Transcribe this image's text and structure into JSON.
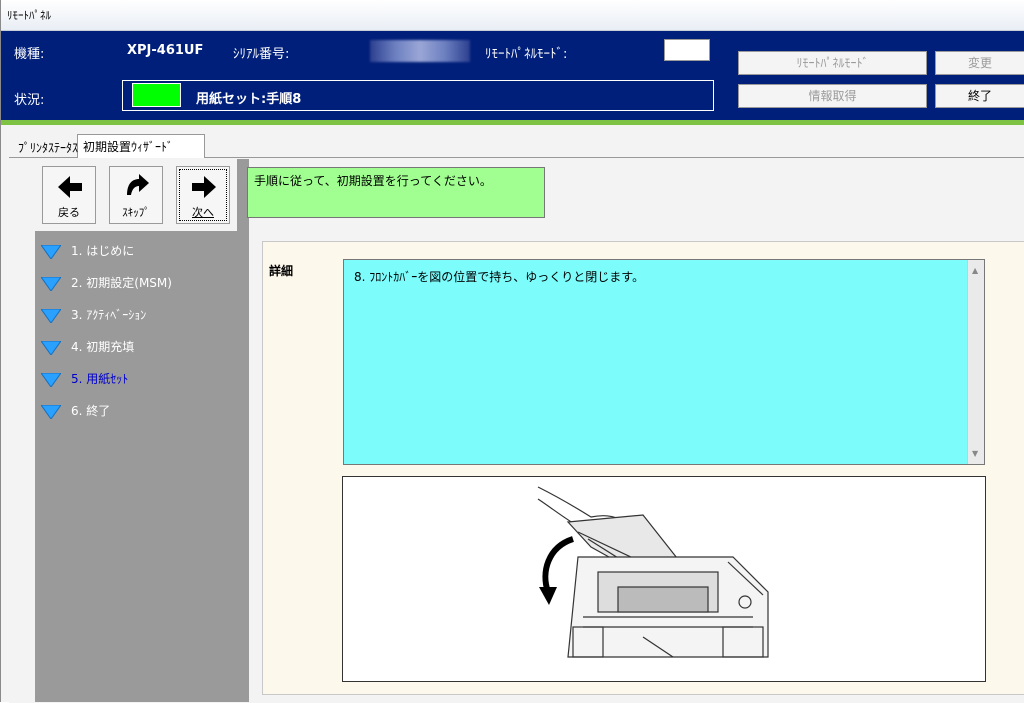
{
  "window": {
    "title": "ﾘﾓｰﾄﾊﾟﾈﾙ"
  },
  "header": {
    "model_label": "機種:",
    "model_value": "XPJ-461UF",
    "serial_label": "ｼﾘｱﾙ番号:",
    "remote_mode_label": "ﾘﾓｰﾄﾊﾟﾈﾙﾓｰﾄﾞ:",
    "status_label": "状況:",
    "status_value": "用紙セット:手順8",
    "status_color": "#00ff00",
    "buttons": {
      "remote_mode": "ﾘﾓｰﾄﾊﾟﾈﾙﾓｰﾄﾞ",
      "change": "変更",
      "get_info": "情報取得",
      "exit": "終了"
    }
  },
  "tabs": [
    {
      "label": "ﾌﾟﾘﾝﾀｽﾃｰﾀｽ",
      "active": false
    },
    {
      "label": "初期設置ｳｨｻﾞｰﾄﾞ",
      "active": true
    }
  ],
  "nav": {
    "back": "戻る",
    "skip": "ｽｷｯﾌﾟ",
    "next": "次へ"
  },
  "message": "手順に従って、初期設置を行ってください。",
  "steps": [
    {
      "label": "1. はじめに",
      "current": false
    },
    {
      "label": "2. 初期設定(MSM)",
      "current": false
    },
    {
      "label": "3. ｱｸﾃｨﾍﾞｰｼｮﾝ",
      "current": false
    },
    {
      "label": "4. 初期充填",
      "current": false
    },
    {
      "label": "5. 用紙ｾｯﾄ",
      "current": true
    },
    {
      "label": "6. 終了",
      "current": false
    }
  ],
  "detail": {
    "label": "詳細",
    "text": "8. ﾌﾛﾝﾄｶﾊﾞｰを図の位置で持ち、ゆっくりと閉じます。"
  },
  "colors": {
    "header_bg": "#001f7a",
    "accent_green": "#7dc242",
    "message_bg": "#a0ff90",
    "detail_bg": "#7dfcfc",
    "current_step": "#0000cc"
  }
}
